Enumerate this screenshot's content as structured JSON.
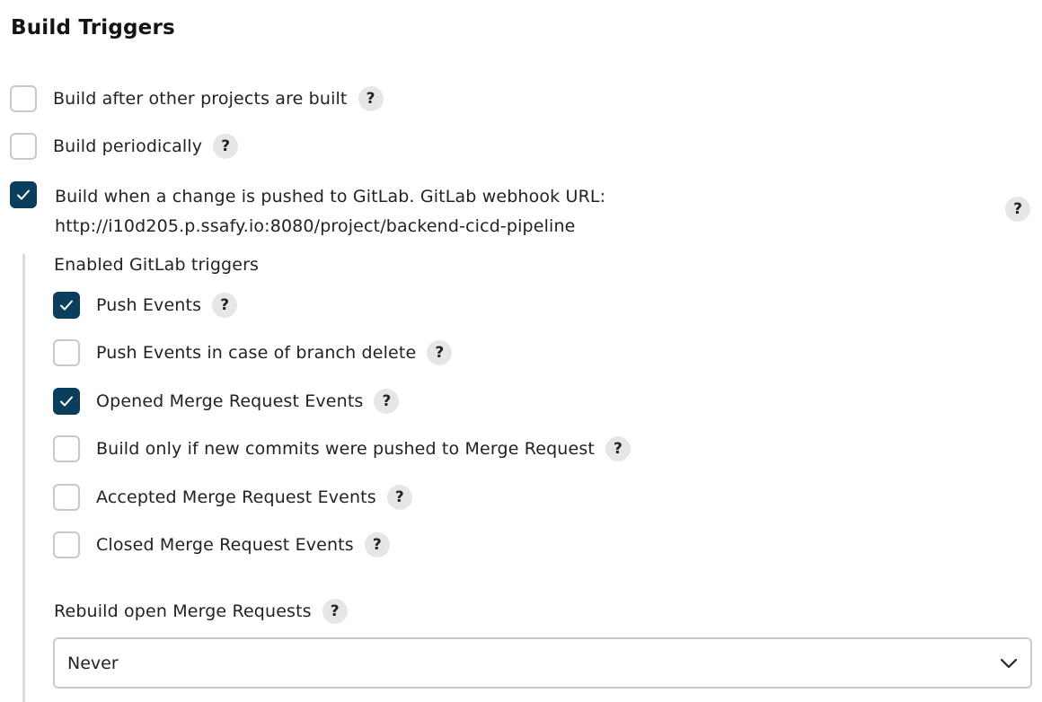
{
  "section": {
    "title": "Build Triggers"
  },
  "triggers": [
    {
      "label": "Build after other projects are built",
      "checked": false
    },
    {
      "label": "Build periodically",
      "checked": false
    },
    {
      "label": "Build when a change is pushed to GitLab. GitLab webhook URL:",
      "url": "http://i10d205.p.ssafy.io:8080/project/backend-cicd-pipeline",
      "checked": true
    }
  ],
  "gitlab": {
    "enabled_label": "Enabled GitLab triggers",
    "events": [
      {
        "label": "Push Events",
        "checked": true
      },
      {
        "label": "Push Events in case of branch delete",
        "checked": false
      },
      {
        "label": "Opened Merge Request Events",
        "checked": true
      },
      {
        "label": "Build only if new commits were pushed to Merge Request",
        "checked": false
      },
      {
        "label": "Accepted Merge Request Events",
        "checked": false
      },
      {
        "label": "Closed Merge Request Events",
        "checked": false
      }
    ],
    "rebuild": {
      "label": "Rebuild open Merge Requests",
      "selected": "Never"
    }
  },
  "help_glyph": "?",
  "colors": {
    "checked_fill": "#0b3d5c",
    "unchecked_border": "#c6c9cd",
    "help_bg": "#e6e6e6",
    "section_rule": "#dcdcdc"
  },
  "icons": {
    "check": "check-icon",
    "help": "help-icon",
    "dropdown": "chevron-down-icon"
  }
}
